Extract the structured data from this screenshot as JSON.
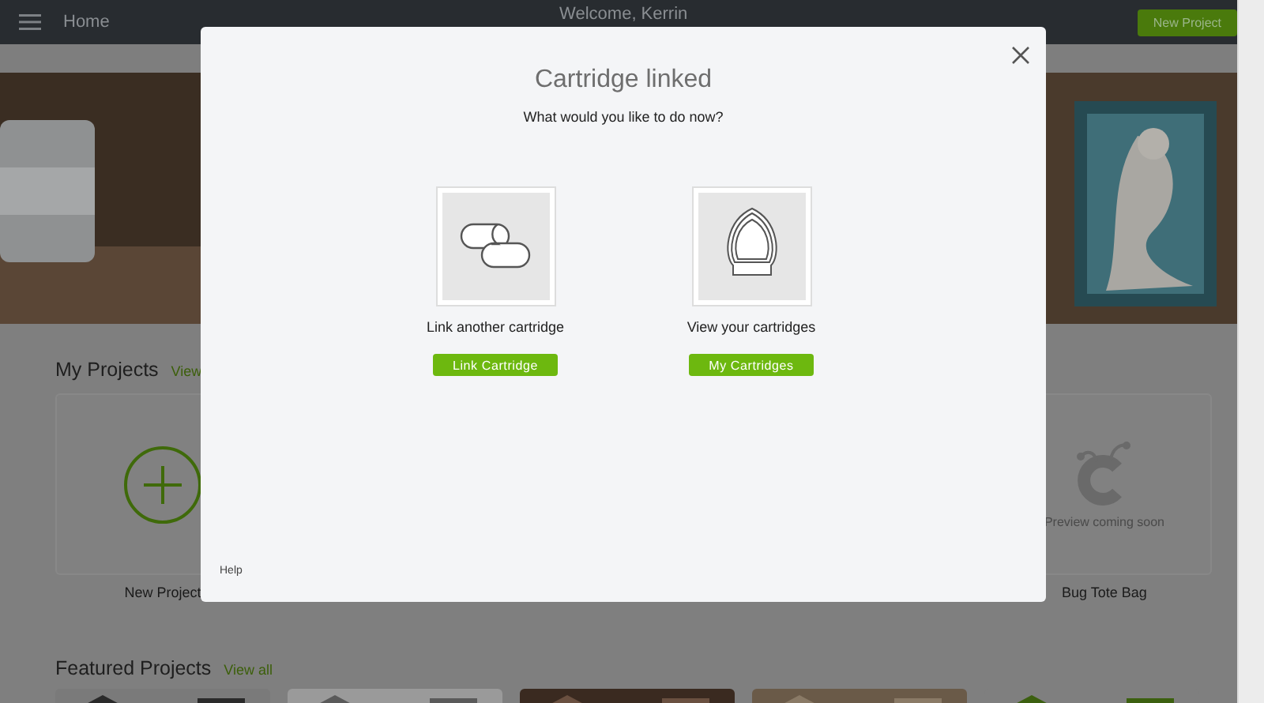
{
  "header": {
    "home": "Home",
    "welcome": "Welcome, Kerrin",
    "new_project": "New Project"
  },
  "my_projects": {
    "title": "My Projects",
    "view_link": "View",
    "cards": [
      {
        "kind": "new",
        "label": "New Project"
      },
      {
        "kind": "preview",
        "preview": "Preview coming soon",
        "label": "Bug Tote Bag"
      }
    ]
  },
  "featured": {
    "title": "Featured Projects",
    "view_link": "View all"
  },
  "modal": {
    "title": "Cartridge linked",
    "prompt": "What would you like to do now?",
    "options": [
      {
        "kind": "link",
        "caption": "Link another cartridge",
        "button": "Link Cartridge"
      },
      {
        "kind": "cartridges",
        "caption": "View your cartridges",
        "button": "My Cartridges"
      }
    ],
    "help": "Help"
  }
}
